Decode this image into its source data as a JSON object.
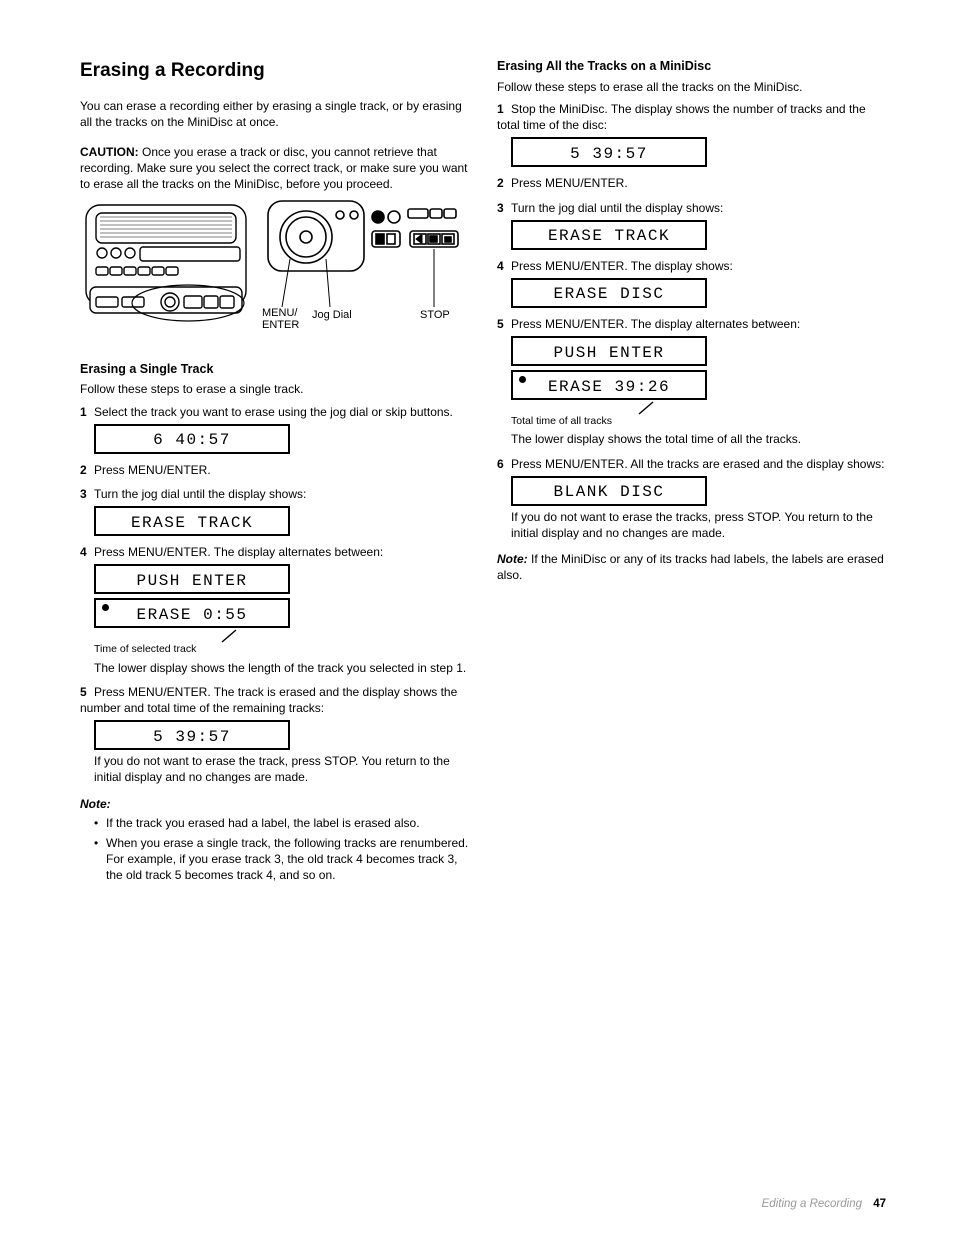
{
  "title": "Erasing a Recording",
  "intro": "You can erase a recording either by erasing a single track, or by erasing all the tracks on the MiniDisc at once.",
  "caution_hd": "CAUTION:",
  "caution_body": "Once you erase a track or disc, you cannot retrieve that recording. Make sure you select the correct track, or make sure you want to erase all the tracks on the MiniDisc, before you proceed.",
  "dev_labels": {
    "menu": "MENU/\nENTER",
    "jog": "Jog Dial",
    "stop": "STOP"
  },
  "single_hd": "Erasing a Single Track",
  "single_intro": "Follow these steps to erase a single track.",
  "single_steps": [
    "Select the track you want to erase using the jog dial or skip buttons.",
    "Press MENU/ENTER.",
    "Turn the jog dial until the display shows:",
    "Press MENU/ENTER. The display alternates between:"
  ],
  "single_after4": "The lower display shows the length of the track you selected in step 1.",
  "single_step5_a": "Press MENU/ENTER. The track is erased and the display shows the number and total time of the remaining tracks:",
  "single_step5_b": "If you do not want to erase the track, press STOP. You return to the initial display and no changes are made.",
  "single_note_hd": "Note:",
  "single_notes": [
    "If the track you erased had a label, the label is erased also.",
    "When you erase a single track, the following tracks are renumbered. For example, if you erase track 3, the old track 4 becomes track 3, the old track 5 becomes track 4, and so on."
  ],
  "all_hd": "Erasing All the Tracks on a MiniDisc",
  "all_intro": "Follow these steps to erase all the tracks on the MiniDisc.",
  "all_step1": "Stop the MiniDisc. The display shows the number of tracks and the total time of the disc:",
  "all_step2": "Press MENU/ENTER.",
  "all_step3": "Turn the jog dial until the display shows:",
  "all_step4": "Press MENU/ENTER. The display shows:",
  "all_step5": "Press MENU/ENTER. The display alternates between:",
  "all_after5": "The lower display shows the total time of all the tracks.",
  "all_step6_a": "Press MENU/ENTER. All the tracks are erased and the display shows:",
  "all_step6_b": "If you do not want to erase the tracks, press STOP. You return to the initial display and no changes are made.",
  "all_note_hd": "Note:",
  "all_note": "If the MiniDisc or any of its tracks had labels, the labels are erased also.",
  "lcd": {
    "s_step1": "6  40:57",
    "s_step3": "ERASE TRACK",
    "s_step4a": "PUSH ENTER",
    "s_step4b": "ERASE  0:55",
    "s_cap4": "Time of selected track",
    "s_step5": "5  39:57",
    "a_step1": "5  39:57",
    "a_step3": "ERASE TRACK",
    "a_step4": "ERASE DISC",
    "a_step5a": "PUSH ENTER",
    "a_step5b": "ERASE 39:26",
    "a_cap5": "Total time of all tracks",
    "a_step6": "BLANK DISC"
  },
  "foot_label": "Editing a Recording",
  "foot_page": "47"
}
